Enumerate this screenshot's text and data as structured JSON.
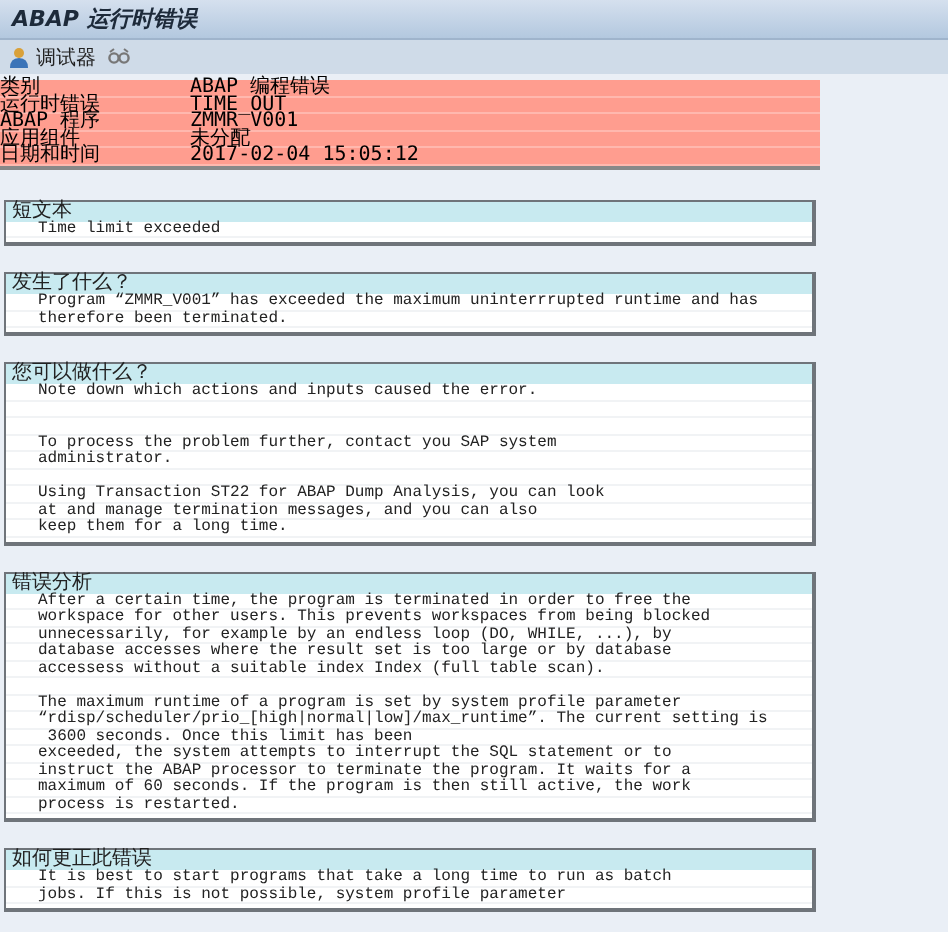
{
  "window": {
    "title": "ABAP 运行时错误"
  },
  "toolbar": {
    "items": [
      {
        "kind": "debugger",
        "label": "调试器"
      },
      {
        "kind": "icon"
      }
    ]
  },
  "header": {
    "rows": [
      {
        "label": "类别",
        "value": "ABAP 编程错误"
      },
      {
        "label": "运行时错误",
        "value": "TIME_OUT"
      },
      {
        "label": "ABAP 程序",
        "value": "ZMMR_V001"
      },
      {
        "label": "应用组件",
        "value": "未分配"
      },
      {
        "label": "日期和时间",
        "value": "2017-02-04 15:05:12"
      }
    ]
  },
  "sections": [
    {
      "title": "短文本",
      "lines": [
        {
          "kind": "text",
          "text": "Time limit exceeded"
        }
      ]
    },
    {
      "title": "发生了什么？",
      "lines": [
        {
          "kind": "text",
          "text": "Program “ZMMR_V001” has exceeded the maximum uninterrrupted runtime and has"
        },
        {
          "kind": "text",
          "text": "therefore been terminated."
        }
      ]
    },
    {
      "title": "您可以做什么？",
      "lines": [
        {
          "kind": "text",
          "text": "Note down which actions and inputs caused the error."
        },
        {
          "kind": "blank"
        },
        {
          "kind": "blank"
        },
        {
          "kind": "text",
          "text": "To process the problem further, contact you SAP system"
        },
        {
          "kind": "text",
          "text": "administrator."
        },
        {
          "kind": "blank"
        },
        {
          "kind": "text",
          "text": "Using Transaction ST22 for ABAP Dump Analysis, you can look"
        },
        {
          "kind": "text",
          "text": "at and manage termination messages, and you can also"
        },
        {
          "kind": "text",
          "text": "keep them for a long time."
        }
      ]
    },
    {
      "title": "错误分析",
      "lines": [
        {
          "kind": "text",
          "text": "After a certain time, the program is terminated in order to free the"
        },
        {
          "kind": "text",
          "text": "workspace for other users. This prevents workspaces from being blocked"
        },
        {
          "kind": "text",
          "text": "unnecessarily, for example by an endless loop (DO, WHILE, ...), by"
        },
        {
          "kind": "text",
          "text": "database accesses where the result set is too large or by database"
        },
        {
          "kind": "text",
          "text": "accessess without a suitable index Index (full table scan)."
        },
        {
          "kind": "blank"
        },
        {
          "kind": "text",
          "text": "The maximum runtime of a program is set by system profile parameter"
        },
        {
          "kind": "text",
          "text": "“rdisp/scheduler/prio_[high|normal|low]/max_runtime”. The current setting is"
        },
        {
          "kind": "text",
          "text": " 3600 seconds. Once this limit has been"
        },
        {
          "kind": "text",
          "text": "exceeded, the system attempts to interrupt the SQL statement or to"
        },
        {
          "kind": "text",
          "text": "instruct the ABAP processor to terminate the program. It waits for a"
        },
        {
          "kind": "text",
          "text": "maximum of 60 seconds. If the program is then still active, the work"
        },
        {
          "kind": "text",
          "text": "process is restarted."
        }
      ]
    },
    {
      "title": "如何更正此错误",
      "lines": [
        {
          "kind": "text",
          "text": "It is best to start programs that take a long time to run as batch"
        },
        {
          "kind": "text",
          "text": "jobs. If this is not possible, system profile parameter"
        }
      ]
    }
  ]
}
